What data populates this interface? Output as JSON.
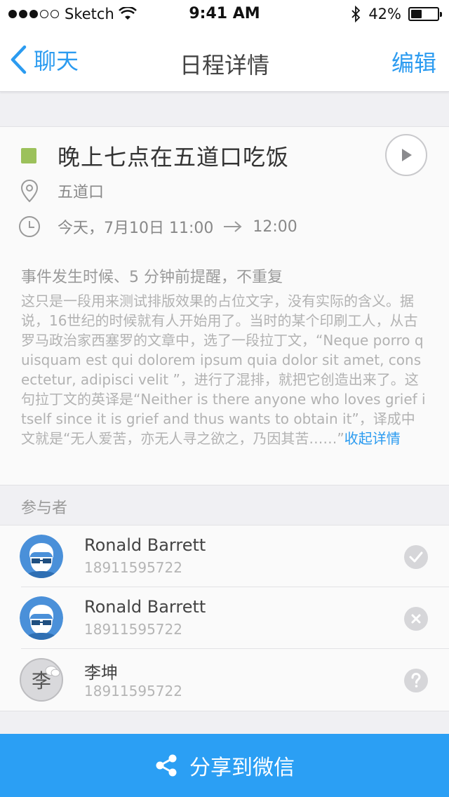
{
  "status_bar": {
    "carrier": "Sketch",
    "time": "9:41 AM",
    "battery_text": "42%",
    "battery_level": 0.42
  },
  "nav": {
    "back_label": "聊天",
    "title": "日程详情",
    "edit_label": "编辑"
  },
  "event": {
    "color": "#9cc15b",
    "title": "晚上七点在五道口吃饭",
    "location": "五道口",
    "date": "今天，7月10日 11:00",
    "end_time": "12:00",
    "reminder": "事件发生时候、5 分钟前提醒，不重复",
    "description": "这只是一段用来测试排版效果的占位文字，没有实际的含义。据说，16世纪的时候就有人开始用了。当时的某个印刷工人，从古罗马政治家西塞罗的文章中，选了一段拉丁文，“Neque porro quisquam est qui dolorem ipsum quia dolor sit amet, consectetur, adipisci velit ”，进行了混排，就把它创造出来了。这句拉丁文的英译是“Neither is there anyone who loves grief itself since it is grief and thus wants to obtain it”，译成中文就是“无人爱苦，亦无人寻之欲之，乃因其苦……”",
    "collapse_label": "收起详情"
  },
  "participants": {
    "label": "参与者",
    "items": [
      {
        "name": "Ronald Barrett",
        "phone": "18911595722",
        "status_icon": "check-icon"
      },
      {
        "name": "Ronald Barrett",
        "phone": "18911595722",
        "status_icon": "x-icon"
      },
      {
        "name": "李坤",
        "phone": "18911595722",
        "avatar_letter": "李",
        "status_icon": "question-icon"
      }
    ]
  },
  "share": {
    "label": "分享到微信"
  },
  "colors": {
    "accent": "#2b9bf0",
    "share_bg": "#2b9ff4",
    "avatar_bg": "#4a90d9"
  }
}
